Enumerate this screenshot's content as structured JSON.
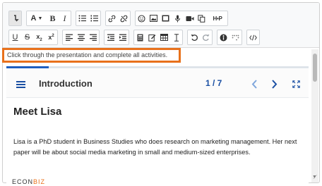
{
  "hint": {
    "text": "Click through the presentation and complete all activities."
  },
  "toolbar": {
    "h5p_label": "H•P"
  },
  "presentation": {
    "section_title": "Introduction",
    "counter": "1 / 7",
    "progress_fraction": 0.14,
    "slide_title": "Meet Lisa",
    "slide_text": "Lisa is a PhD student in Business Studies who does research on marketing management. Her next paper will be about social media marketing in small and medium-sized enterprises.",
    "logo_main": "ECON",
    "logo_accent": "BIZ"
  },
  "colors": {
    "highlight": "#e8711c",
    "accent": "#1a4fa3"
  }
}
